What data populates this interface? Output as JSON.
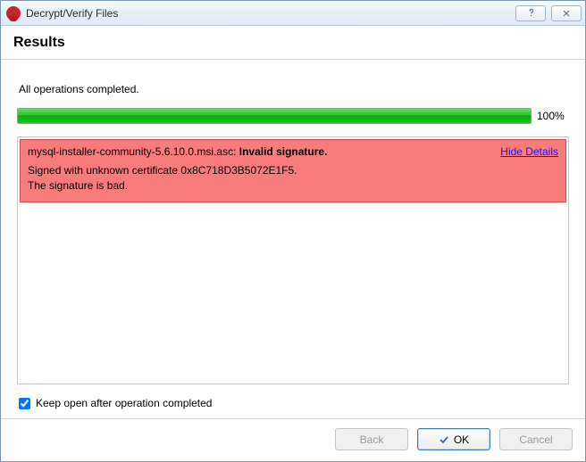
{
  "window": {
    "title": "Decrypt/Verify Files"
  },
  "header": {
    "title": "Results"
  },
  "status": {
    "text": "All operations completed."
  },
  "progress": {
    "percent": 100,
    "label": "100%"
  },
  "error": {
    "filename": "mysql-installer-community-5.6.10.0.msi.asc: ",
    "verdict": "Invalid signature.",
    "hide_details_label": "Hide Details",
    "line1": "Signed with unknown certificate 0x8C718D3B5072E1F5.",
    "line2": "The signature is bad."
  },
  "keep_open": {
    "checked": true,
    "label": "Keep open after operation completed"
  },
  "buttons": {
    "back": "Back",
    "ok": "OK",
    "cancel": "Cancel"
  }
}
